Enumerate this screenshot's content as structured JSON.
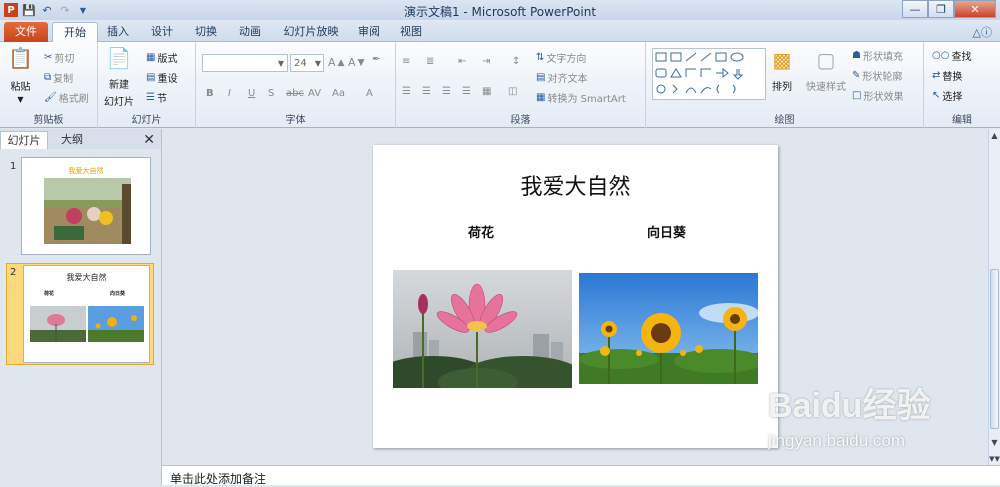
{
  "window": {
    "title": "演示文稿1 - Microsoft PowerPoint"
  },
  "tabs": [
    {
      "label": "文件"
    },
    {
      "label": "开始"
    },
    {
      "label": "插入"
    },
    {
      "label": "设计"
    },
    {
      "label": "切换"
    },
    {
      "label": "动画"
    },
    {
      "label": "幻灯片放映"
    },
    {
      "label": "审阅"
    },
    {
      "label": "视图"
    }
  ],
  "ribbon": {
    "clipboard": {
      "label": "剪贴板",
      "paste": "粘贴",
      "cut": "剪切",
      "copy": "复制",
      "format_painter": "格式刷"
    },
    "slides": {
      "label": "幻灯片",
      "new_slide_line1": "新建",
      "new_slide_line2": "幻灯片",
      "layout": "版式",
      "reset": "重设",
      "section": "节"
    },
    "font": {
      "label": "字体",
      "font_size": "24"
    },
    "paragraph": {
      "label": "段落",
      "text_direction": "文字方向",
      "align_text": "对齐文本",
      "smartart": "转换为 SmartArt"
    },
    "drawing": {
      "label": "绘图",
      "arrange": "排列",
      "quick_styles": "快速样式",
      "shape_fill": "形状填充",
      "shape_outline": "形状轮廓",
      "shape_effects": "形状效果"
    },
    "editing": {
      "label": "编辑",
      "find": "查找",
      "replace": "替换",
      "select": "选择"
    }
  },
  "panel": {
    "tab_slides": "幻灯片",
    "tab_outline": "大纲"
  },
  "thumbnails": [
    {
      "number": "1",
      "title": "我爱大自然"
    },
    {
      "number": "2",
      "title": "我爱大自然",
      "label1": "荷花",
      "label2": "向日葵"
    }
  ],
  "slide": {
    "title": "我爱大自然",
    "label_left": "荷花",
    "label_right": "向日葵"
  },
  "notes": {
    "placeholder": "单击此处添加备注"
  },
  "watermark": {
    "brand": "Baidu经验",
    "url": "jingyan.baidu.com"
  },
  "colors": {
    "file_tab": "#d2512a",
    "ribbon_bg": "#f3f6fb",
    "selection": "#fcd97c"
  }
}
